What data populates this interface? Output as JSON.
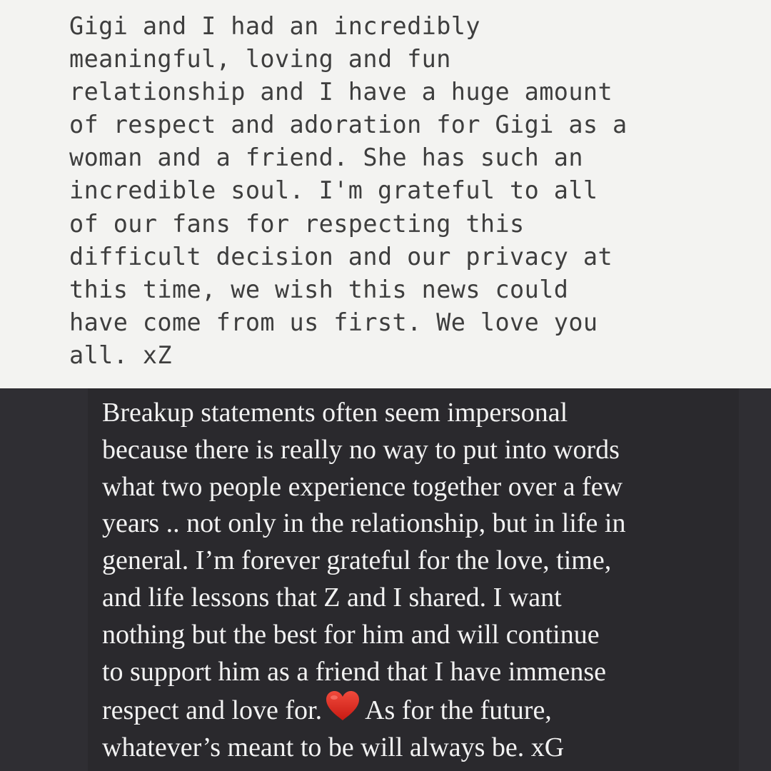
{
  "statement_z": {
    "lines": [
      "Gigi and I had an incredibly",
      "meaningful, loving and fun",
      "relationship and I have a huge amount",
      "of respect and adoration for Gigi as a",
      "woman and a friend. She has such an",
      "incredible soul. I'm grateful to all",
      "of our fans for respecting this",
      "difficult decision and our privacy at",
      "this time, we wish this news could",
      "have come from us first. We love you",
      "all. xZ"
    ]
  },
  "statement_g": {
    "lines": [
      "Breakup statements often seem impersonal",
      "because there is really no way to put into words",
      "what two people experience together over a few",
      "years .. not only in the relationship, but in life in",
      "general. I’m forever grateful for the love, time,",
      "and life lessons that Z and I shared. I want",
      "nothing but the best for him and will continue",
      "to support him as a friend that I have immense"
    ],
    "line9_before": "respect and love for.",
    "line9_after": "As for the future,",
    "last_line": "whatever’s meant to be will always be. xG",
    "emoji": "red-heart",
    "heart_color": "#e0241c"
  }
}
